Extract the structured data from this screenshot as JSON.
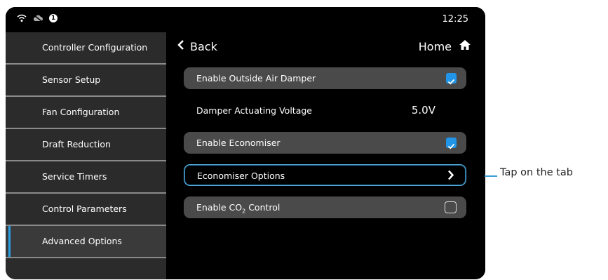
{
  "status": {
    "time": "12:25",
    "notification_count": "1"
  },
  "sidebar": {
    "items": [
      {
        "label": "Controller Configuration"
      },
      {
        "label": "Sensor Setup"
      },
      {
        "label": "Fan Configuration"
      },
      {
        "label": "Draft Reduction"
      },
      {
        "label": "Service Timers"
      },
      {
        "label": "Control Parameters"
      },
      {
        "label": "Advanced Options",
        "active": true
      }
    ]
  },
  "header": {
    "back_label": "Back",
    "home_label": "Home"
  },
  "settings": {
    "rows": [
      {
        "label": "Enable Outside Air Damper",
        "checked": true
      },
      {
        "label": "Damper Actuating Voltage",
        "value": "5.0V"
      },
      {
        "label": "Enable Economiser",
        "checked": true
      },
      {
        "label": "Economiser Options"
      },
      {
        "label_prefix": "Enable CO",
        "label_sub": "2",
        "label_suffix": " Control",
        "checked": false
      }
    ]
  },
  "annotation": {
    "text": "Tap on the tab"
  },
  "colors": {
    "accent": "#2196e8",
    "highlight_outline": "#5aaedc",
    "row_bg": "#4a4a4a",
    "sidebar_bg": "#2b2b2b"
  }
}
